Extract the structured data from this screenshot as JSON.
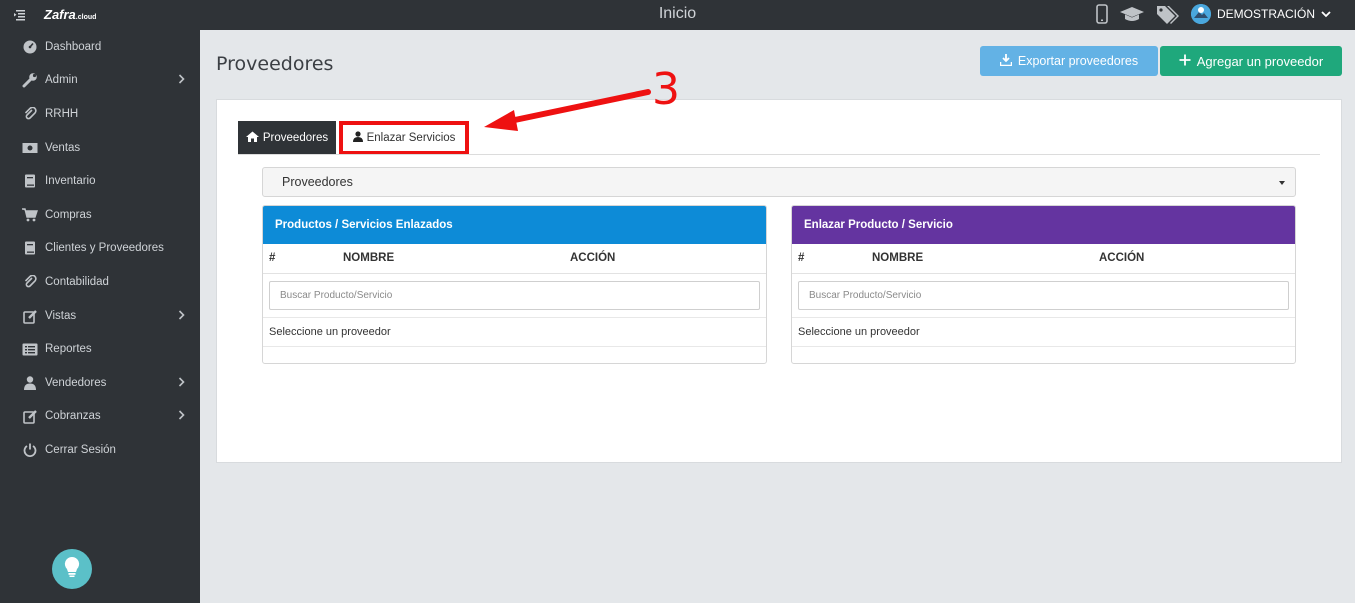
{
  "app": {
    "logo_text": "Zafra",
    "logo_suffix": ".cloud",
    "page_header": "Inicio",
    "user_name": "DEMOSTRACIÓN"
  },
  "sidebar": {
    "items": [
      {
        "label": "Dashboard",
        "icon": "dashboard-icon",
        "has_submenu": false
      },
      {
        "label": "Admin",
        "icon": "wrench-icon",
        "has_submenu": true
      },
      {
        "label": "RRHH",
        "icon": "paperclip-icon",
        "has_submenu": false
      },
      {
        "label": "Ventas",
        "icon": "money-icon",
        "has_submenu": false
      },
      {
        "label": "Inventario",
        "icon": "book-icon",
        "has_submenu": false
      },
      {
        "label": "Compras",
        "icon": "cart-icon",
        "has_submenu": false
      },
      {
        "label": "Clientes y Proveedores",
        "icon": "book-icon",
        "has_submenu": false
      },
      {
        "label": "Contabilidad",
        "icon": "paperclip-icon",
        "has_submenu": false
      },
      {
        "label": "Vistas",
        "icon": "edit-icon",
        "has_submenu": true
      },
      {
        "label": "Reportes",
        "icon": "list-icon",
        "has_submenu": false
      },
      {
        "label": "Vendedores",
        "icon": "user-icon",
        "has_submenu": true
      },
      {
        "label": "Cobranzas",
        "icon": "edit-icon",
        "has_submenu": true
      },
      {
        "label": "Cerrar Sesión",
        "icon": "power-icon",
        "has_submenu": false
      }
    ]
  },
  "main": {
    "title": "Proveedores",
    "export_label": "Exportar proveedores",
    "add_label": "Agregar un proveedor",
    "tabs": [
      {
        "label": "Proveedores",
        "active": true
      },
      {
        "label": "Enlazar Servicios",
        "active": false
      }
    ],
    "select_value": "Proveedores",
    "panels": [
      {
        "title": "Productos / Servicios Enlazados",
        "color": "#0d8bd7",
        "columns": [
          "#",
          "NOMBRE",
          "ACCIÓN"
        ],
        "search_placeholder": "Buscar Producto/Servicio",
        "message": "Seleccione un proveedor"
      },
      {
        "title": "Enlazar Producto / Servicio",
        "color": "#6434a0",
        "columns": [
          "#",
          "NOMBRE",
          "ACCIÓN"
        ],
        "search_placeholder": "Buscar Producto/Servicio",
        "message": "Seleccione un proveedor"
      }
    ]
  },
  "annotation": {
    "number": "3",
    "color": "#ee1111"
  },
  "colors": {
    "sidebar_bg": "#2f3337",
    "export_button": "#63b2e5",
    "add_button": "#1fa87c"
  }
}
